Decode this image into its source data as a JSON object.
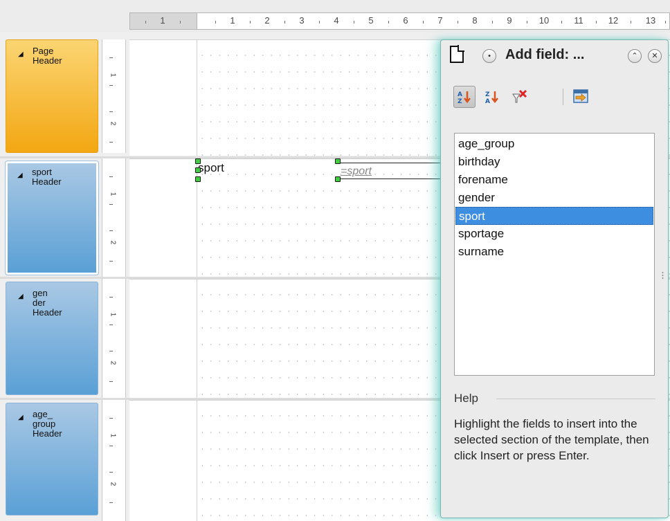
{
  "ruler": {
    "labels": [
      "1",
      "1",
      "2",
      "3",
      "4",
      "5",
      "6",
      "7",
      "8",
      "9",
      "10",
      "11",
      "12",
      "13"
    ]
  },
  "sections": [
    {
      "label": "Page\nHeader"
    },
    {
      "label": "sport\nHeader"
    },
    {
      "label": "gen\nder\nHeader"
    },
    {
      "label": "age_\ngroup\nHeader"
    }
  ],
  "vertical_ruler": {
    "marks": [
      "1",
      "2"
    ]
  },
  "report": {
    "field_label_text": "sport",
    "field_value_text": "=sport"
  },
  "dialog": {
    "title": "Add field: ...",
    "toolbar": {
      "sort_ascending_icon": "sort-ascending-icon",
      "sort_descending_icon": "sort-descending-icon",
      "remove_sort_icon": "remove-sort-icon",
      "insert_icon": "insert-field-icon"
    },
    "fields": [
      "age_group",
      "birthday",
      "forename",
      "gender",
      "sport",
      "sportage",
      "surname"
    ],
    "selected_field": "sport",
    "help_heading": "Help",
    "help_text": "Highlight the fields to insert into the selected section of the template, then click Insert or press Enter."
  },
  "colors": {
    "page_header": "#f3a712",
    "group_header": "#5aa0d6",
    "selection": "#3d8ee0",
    "dialog_glow": "#5ac8be",
    "handle": "#3ed13e"
  }
}
